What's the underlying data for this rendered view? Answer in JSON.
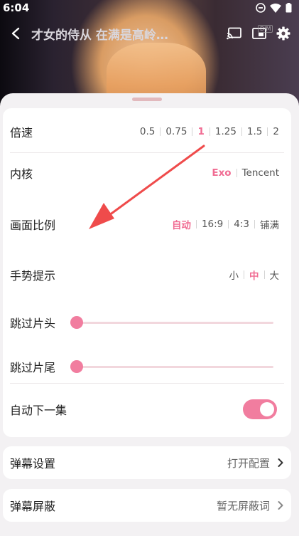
{
  "status_bar": {
    "time": "6:04"
  },
  "player": {
    "title": "才女的侍从 在满是高岭…",
    "pip_badge": "DIM"
  },
  "settings": {
    "speed": {
      "label": "倍速",
      "options": [
        "0.5",
        "0.75",
        "1",
        "1.25",
        "1.5",
        "2"
      ],
      "selected": "1"
    },
    "kernel": {
      "label": "内核",
      "options": [
        "Exo",
        "Tencent"
      ],
      "selected": "Exo"
    },
    "aspect_ratio": {
      "label": "画面比例",
      "options": [
        "自动",
        "16:9",
        "4:3",
        "铺满"
      ],
      "selected": "自动"
    },
    "gesture_hint": {
      "label": "手势提示",
      "options": [
        "小",
        "中",
        "大"
      ],
      "selected": "中"
    },
    "skip_intro": {
      "label": "跳过片头",
      "value": 0
    },
    "skip_outro": {
      "label": "跳过片尾",
      "value": 0
    },
    "auto_next": {
      "label": "自动下一集",
      "enabled": true
    }
  },
  "danmaku_settings": {
    "label": "弹幕设置",
    "value": "打开配置"
  },
  "danmaku_block": {
    "label": "弹幕屏蔽",
    "value": "暂无屏蔽词"
  },
  "colors": {
    "accent": "#f06b92",
    "toggle_on": "#f17d9f",
    "annotation_arrow": "#ef4b4b"
  },
  "icons": {
    "status": [
      "dnd-icon",
      "wifi-icon",
      "battery-icon"
    ],
    "player": [
      "back-icon",
      "cast-icon",
      "pip-icon",
      "settings-gear-icon"
    ],
    "nav": [
      "chevron-right-icon"
    ]
  }
}
